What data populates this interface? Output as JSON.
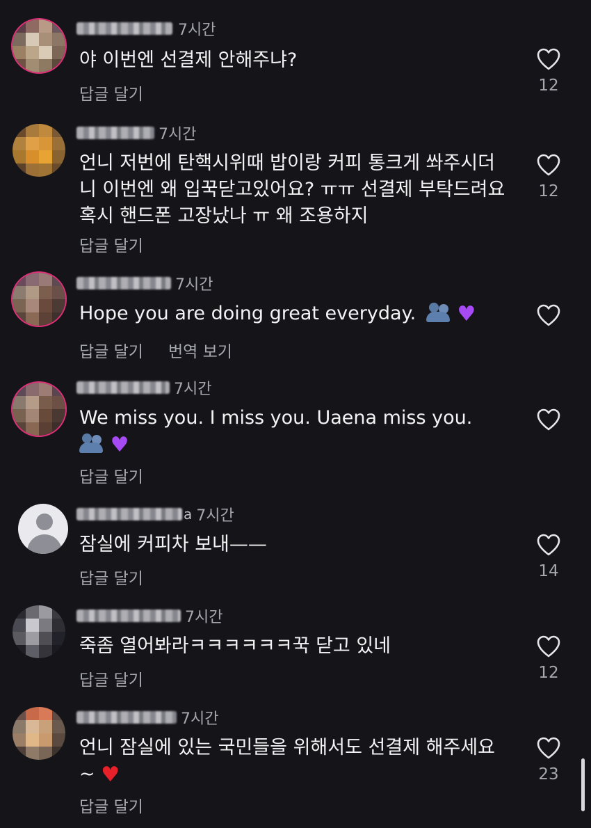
{
  "comments": [
    {
      "name_tail": "",
      "time": "7시간",
      "text": "야 이번엔 선결제 안해주냐?",
      "reply": "답글 달기",
      "likes": "12"
    },
    {
      "name_tail": "",
      "time": "7시간",
      "text": "언니 저번에 탄핵시위때 밥이랑 커피 통크게 쏴주시더니 이번엔 왜 입꾹닫고있어요? ㅠㅠ 선결제 부탁드려요 혹시 핸드폰 고장났나 ㅠ 왜 조용하지",
      "reply": "답글 달기",
      "likes": "12"
    },
    {
      "name_tail": "",
      "time": "7시간",
      "text": "Hope you are doing great everyday.",
      "reply": "답글 달기",
      "translate": "번역 보기",
      "likes": ""
    },
    {
      "name_tail": "",
      "time": "7시간",
      "text": "We miss you. I miss you. Uaena miss you.",
      "reply": "답글 달기",
      "likes": ""
    },
    {
      "name_tail": "a",
      "time": "7시간",
      "text": "잠실에 커피차 보내——",
      "reply": "답글 달기",
      "likes": "14"
    },
    {
      "name_tail": "",
      "time": "7시간",
      "text": "죽좀 열어봐라ㅋㅋㅋㅋㅋㅋ꾹 닫고 있네",
      "reply": "답글 달기",
      "likes": "12"
    },
    {
      "name_tail": "",
      "time": "7시간",
      "text": "언니 잠실에 있는 국민들을 위해서도 선결제 해주세요~",
      "reply": "답글 달기",
      "likes": "23"
    }
  ],
  "icons": {
    "like": "heart-outline-icon",
    "emoji_people": "busts-in-silhouette-emoji",
    "emoji_purple_heart": "purple-heart-emoji",
    "emoji_red_heart": "red-heart-emoji"
  },
  "colors": {
    "background": "#151519",
    "text": "#f3f3f5",
    "muted": "#a7a8ae",
    "story_ring": "#e0307a"
  }
}
